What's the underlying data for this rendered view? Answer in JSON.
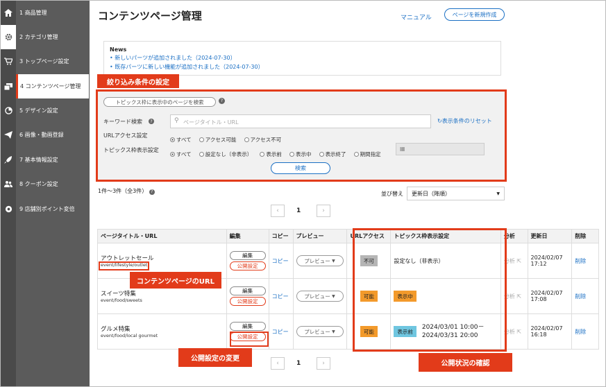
{
  "sidebar": {
    "items": [
      {
        "num": "1",
        "label": "商品管理",
        "icon": "home-icon"
      },
      {
        "num": "2",
        "label": "カテゴリ管理",
        "icon": "gear-icon"
      },
      {
        "num": "3",
        "label": "トップページ設定",
        "icon": "cart-icon"
      },
      {
        "num": "4",
        "label": "コンテンツページ管理",
        "icon": "pages-icon"
      },
      {
        "num": "5",
        "label": "デザイン設定",
        "icon": "pie-icon"
      },
      {
        "num": "6",
        "label": "画像・動画登録",
        "icon": "send-icon"
      },
      {
        "num": "7",
        "label": "基本情報設定",
        "icon": "rocket-icon"
      },
      {
        "num": "8",
        "label": "クーポン設定",
        "icon": "users-icon"
      },
      {
        "num": "9",
        "label": "店舗別ポイント変倍",
        "icon": "target-icon"
      }
    ]
  },
  "header": {
    "title": "コンテンツページ管理",
    "manual": "マニュアル",
    "new_button": "ページを新規作成"
  },
  "news": {
    "heading": "News",
    "items": [
      "新しいパーツが追加されました（2024-07-30）",
      "既存パーツに新しい機能が追加されました（2024-07-30）"
    ]
  },
  "callouts": {
    "filter": "絞り込み条件の設定",
    "url": "コンテンツページのURL",
    "publish": "公開設定の変更",
    "status": "公開状況の確認"
  },
  "filter": {
    "topics_search_button": "トピックス枠に表示中のページを検索",
    "keyword_label": "キーワード検索",
    "keyword_placeholder": "ページタイトル・URL",
    "reset": "表示条件のリセット",
    "url_access_label": "URLアクセス設定",
    "url_access_options": [
      "すべて",
      "アクセス可能",
      "アクセス不可"
    ],
    "topics_label": "トピックス枠表示設定",
    "topics_options": [
      "すべて",
      "設定なし（非表示）",
      "表示前",
      "表示中",
      "表示終了",
      "期間指定"
    ],
    "search_button": "検索"
  },
  "results": {
    "count": "1件〜3件（全3件）",
    "sort_label": "並び替え",
    "sort_value": "更新日（降順）",
    "page": "1",
    "prev": "‹",
    "next": "›"
  },
  "table": {
    "headers": [
      "ページタイトル・URL",
      "編集",
      "コピー",
      "プレビュー",
      "URLアクセス",
      "トピックス枠表示設定",
      "分析",
      "更新日",
      "削除"
    ],
    "edit_label": "編集",
    "publish_label": "公開設定",
    "copy_label": "コピー",
    "preview_label": "プレビュー",
    "analysis_label": "分析",
    "delete_label": "削除",
    "rows": [
      {
        "title": "アウトレットセール",
        "url": "event/lifestyle/outlet",
        "access": "不可",
        "access_color": "#b5b5b5",
        "topics": "設定なし（非表示）",
        "topics_badge": "",
        "topics_badge_color": "",
        "period": "",
        "date": "2024/02/07",
        "time": "17:12"
      },
      {
        "title": "スイーツ特集",
        "url": "event/food/sweets",
        "access": "可能",
        "access_color": "#f39a2b",
        "topics": "",
        "topics_badge": "表示中",
        "topics_badge_color": "#f39a2b",
        "period": "",
        "date": "2024/02/07",
        "time": "17:08"
      },
      {
        "title": "グルメ特集",
        "url": "event/food/local gourmet",
        "access": "可能",
        "access_color": "#f39a2b",
        "topics": "",
        "topics_badge": "表示前",
        "topics_badge_color": "#6fc6e0",
        "period": "2024/03/01 10:00－",
        "period2": "2024/03/31 20:00",
        "date": "2024/02/07",
        "time": "16:18"
      }
    ]
  },
  "colors": {
    "accent": "#e23b1a",
    "link": "#1a6fc4",
    "sidebar": "#5b5b5b"
  }
}
